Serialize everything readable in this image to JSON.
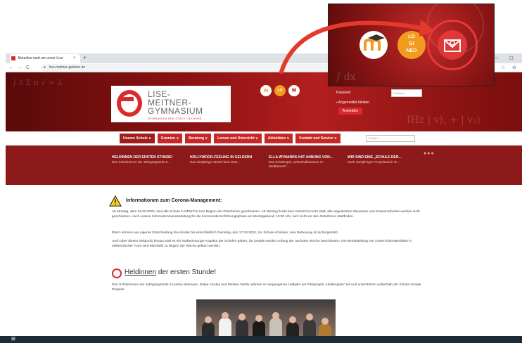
{
  "browser": {
    "tab_title": "Aktuelles rund um unser Lise",
    "tab_close": "×",
    "new_tab": "+",
    "url": "lise-meitner-geldern.de",
    "back": "←",
    "forward": "→",
    "reload": "C",
    "window_min": "–",
    "window_max": "◻",
    "star": "☆",
    "account": "⊖"
  },
  "header": {
    "logo_line1": "LISE-",
    "logo_line2": "MEITNER-",
    "logo_line3": "GYMNASIUM",
    "logo_sub": "GYMNASIUM DER STADT GELDERN",
    "deco_formula": "IHz | v⟩, + | v₂⟩",
    "icons": [
      "moodle-icon",
      "logineo-icon",
      "webmail-icon"
    ],
    "login": {
      "password_label": "Passwort",
      "password_placeholder": "Passwort",
      "remember_label": "Angemeldet bleiben",
      "submit_label": "Anmelden"
    }
  },
  "nav": {
    "items": [
      {
        "label": "Unsere Schule ∨"
      },
      {
        "label": "Gremien ∨"
      },
      {
        "label": "Beratung ∨"
      },
      {
        "label": "Lernen und Unterricht ∨"
      },
      {
        "label": "Aktivitäten ∨"
      },
      {
        "label": "Kontakt und Service ∨"
      }
    ],
    "search_placeholder": "Suchen ..."
  },
  "news": [
    {
      "title": "HELDINNEN DER ERSTEN STUNDE!",
      "text": "Drei Schülerinnen der Jahrgangsstufe 9..."
    },
    {
      "title": "HOLLYWOOD-FEELING IN GELDERN",
      "text": "Das diesjährige Varieté fand unter..."
    },
    {
      "title": "ELLA WYNANDS HAT AHNUNG VON...",
      "text": "Das Schülerquiz „Wirtschaftswissen im Wettbewerb\"..."
    },
    {
      "title": "WIR SIND EINE „SCHULE DER...",
      "text": "Nach zweijährigem Projektarbeit im..."
    }
  ],
  "slider_dots": "●●●",
  "main": {
    "corona_heading": "Informationen zum Corona-Management:",
    "para1": "Ab Montag, dem 16.03.2020, sind alle Schule in NRW bis zum Beginn der Osterferien geschlossen. Ab Montag findet kein Unterricht mehr statt, alle angesetzten Klausuren und Klassenarbeiten werden nicht geschrieben. Auch unsere Informationsveranstaltung für die kommende Einführungsphase am Montagabend, 19:30 Uhr, wird nicht vor den Osterferien stattfinden.",
    "para2": "Eltern können aus eigener Entscheidung ihre Kinder bis einschließlich Dienstag, den 17.03.2020, zur Schule schicken; eine Betreuung ist sichergestellt.",
    "para3": "Auch über diesen Zeitpunkt hinaus wird es ein Notbetreuungs-Angebot der Schulen geben; die Details werden Anfang der nächsten Woche beschlossen. Die Bereitstellung von Unterrichtsmaterialien in elektronischer Form wird ebenfalls zu Beginn der Woche geklärt werden.",
    "heldin_heading_link": "Heldinnen",
    "heldin_heading_rest": " der ersten Stunde!",
    "heldin_text": "Drei Schülerinnen der Jahrgangsstufe 9 (Larisa Wiemann, Dalaa Alcalaa und Melissa Wehl) nahmen im vergangenen Halbjahr am Pilotprojekt „Heldenpass\" teil und unterstützen außerhalb der Schule soziale Projekte."
  },
  "callout": {
    "icons": [
      "moodle-icon",
      "logineo-icon",
      "webmail-icon"
    ],
    "logineo_text_1": "LO",
    "logineo_text_2": "GI",
    "logineo_text_3": "NEO"
  },
  "colors": {
    "brand_red": "#d92b2b",
    "nav_red": "#c62828",
    "band_red": "#8c1a1a",
    "taskbar": "#1e2a38"
  }
}
